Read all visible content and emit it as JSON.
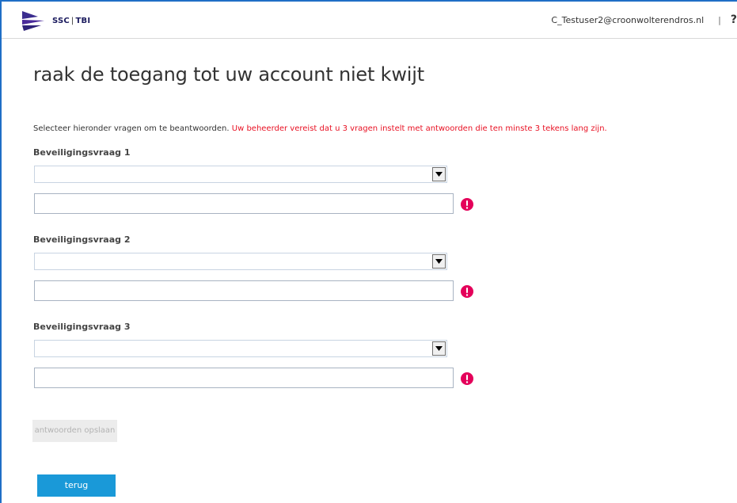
{
  "header": {
    "logo_text": "SSC",
    "logo_separator": "|",
    "logo_sub": "TBI",
    "user_email": "C_Testuser2@croonwolterendros.nl",
    "divider": "|",
    "help_label": "?"
  },
  "page": {
    "title": "raak de toegang tot uw account niet kwijt",
    "instructions": "Selecteer hieronder vragen om te beantwoorden.",
    "warning": "Uw beheerder vereist dat u 3 vragen instelt met antwoorden die ten minste 3 tekens lang zijn."
  },
  "questions": [
    {
      "label": "Beveiligingsvraag 1",
      "selected": "",
      "answer": ""
    },
    {
      "label": "Beveiligingsvraag 2",
      "selected": "",
      "answer": ""
    },
    {
      "label": "Beveiligingsvraag 3",
      "selected": "",
      "answer": ""
    }
  ],
  "buttons": {
    "save_label": "antwoorden opslaan",
    "back_label": "terug"
  },
  "colors": {
    "accent": "#1a99d8",
    "warning": "#e81123",
    "error_icon": "#e4005a",
    "frame": "#1f6fc6"
  }
}
